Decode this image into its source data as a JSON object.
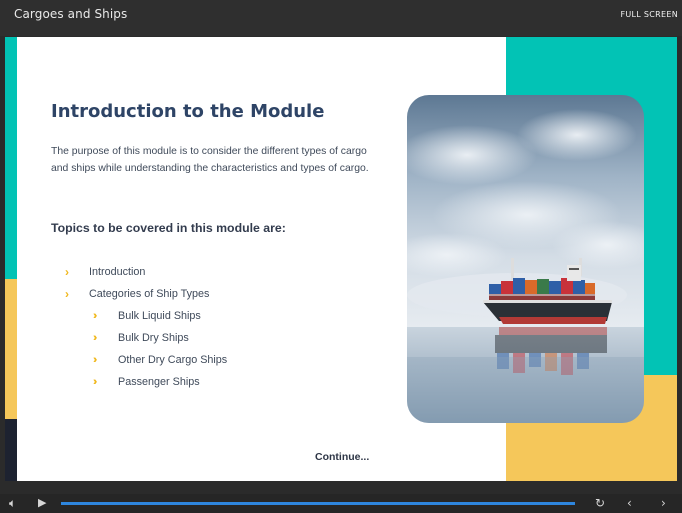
{
  "window": {
    "title": "Cargoes and Ships",
    "fullscreen_label": "FULL SCREEN"
  },
  "slide": {
    "heading": "Introduction to the Module",
    "intro": "The purpose of this module is to consider the different types of cargo and ships while understanding the characteristics and types of cargo.",
    "topics_heading": "Topics to be covered in this module are:",
    "topics": [
      {
        "label": "Introduction",
        "level": 1
      },
      {
        "label": "Categories of Ship Types",
        "level": 1
      },
      {
        "label": "Bulk Liquid Ships",
        "level": 2
      },
      {
        "label": "Bulk Dry Ships",
        "level": 2
      },
      {
        "label": "Other Dry Cargo Ships",
        "level": 2
      },
      {
        "label": "Passenger Ships",
        "level": 2
      }
    ],
    "continue_label": "Continue...",
    "image_icon": "cargo-ship-photo"
  },
  "controls": {
    "progress": 1.0,
    "icons": [
      "volume-icon",
      "play-icon",
      "replay-icon",
      "previous-icon",
      "next-icon"
    ]
  },
  "colors": {
    "teal": "#02c3b5",
    "yellow": "#f5c75a",
    "heading": "#2e4466",
    "chevron": "#f0b81e",
    "progress": "#2e86de"
  }
}
